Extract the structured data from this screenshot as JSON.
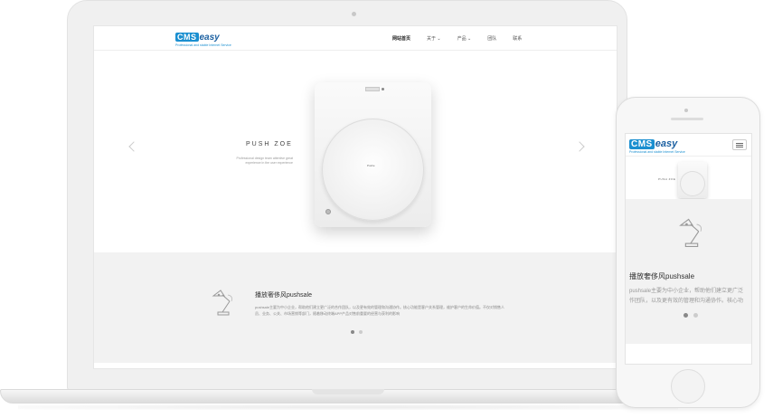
{
  "brand": {
    "logo_cms": "CMS",
    "logo_easy": "easy",
    "logo_tagline": "Professional and stable Internet Service",
    "accent": "#1a8fd0"
  },
  "nav": {
    "items": [
      {
        "label": "网站首页",
        "active": true
      },
      {
        "label": "关于 ⌄",
        "active": false
      },
      {
        "label": "产品 ⌄",
        "active": false
      },
      {
        "label": "团队",
        "active": false
      },
      {
        "label": "联系",
        "active": false
      }
    ]
  },
  "hero": {
    "title": "PUSH ZOE",
    "subtitle": "Professional design team attentive great experience in the user experience",
    "device_label": "Pushe",
    "slide_count": 5,
    "active_slide": 0
  },
  "feature": {
    "title": "播放奢侈风pushsale",
    "text": "pushsale主要为中小企业，帮助他们建立更广泛的合作团队，以及更有效的管理和沟通协作。核心功能是客户关系管理，维护客户的生命价值。不仅对销售人员、业务、公关、市场营销等部门，随着移动终端APP产品对售前重要的经营与获利的影响",
    "slide_count": 2,
    "active_slide": 0
  },
  "mobile": {
    "hero_title": "PUSH ZOE",
    "feature_title": "播放奢侈风pushsale",
    "feature_text_line1": "pushsale主要为中小企业，帮助他们建立更广泛",
    "feature_text_line2": "作团队，以及更有效的管理和沟通协作。核心功",
    "slide_count": 2,
    "active_slide": 0
  }
}
